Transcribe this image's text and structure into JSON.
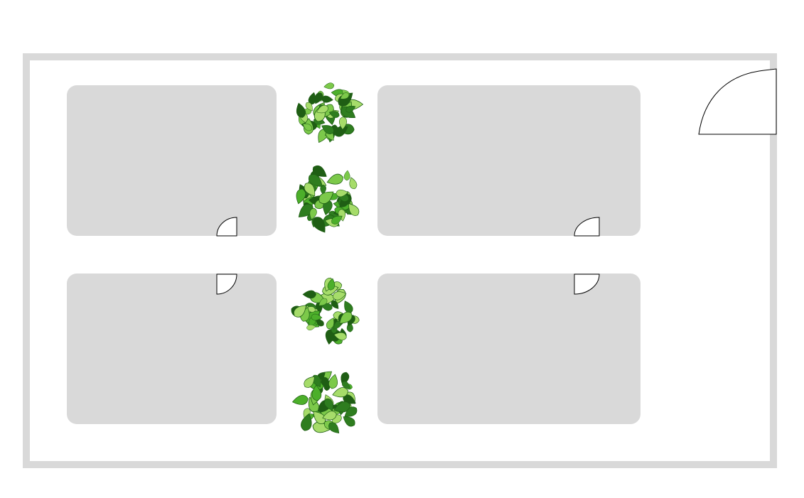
{
  "floorplan": {
    "wall_color": "#d9d9d9",
    "room_color": "#d9d9d9",
    "floor_color": "#ffffff",
    "door_stroke": "#000000",
    "plant_colors": [
      "#2e7d1f",
      "#4caf2a",
      "#7cc94a",
      "#a6dc6a",
      "#1f5e14"
    ],
    "rooms": [
      {
        "id": "room-top-left",
        "door": "bottom"
      },
      {
        "id": "room-top-right",
        "door": "bottom"
      },
      {
        "id": "room-bottom-left",
        "door": "top"
      },
      {
        "id": "room-bottom-right",
        "door": "top"
      }
    ],
    "plants": [
      {
        "id": "plant-1",
        "icon": "potted-plant-icon"
      },
      {
        "id": "plant-2",
        "icon": "potted-plant-icon"
      },
      {
        "id": "plant-3",
        "icon": "potted-plant-icon"
      },
      {
        "id": "plant-4",
        "icon": "potted-plant-icon"
      }
    ],
    "entrance": {
      "icon": "entrance-door-icon"
    }
  }
}
